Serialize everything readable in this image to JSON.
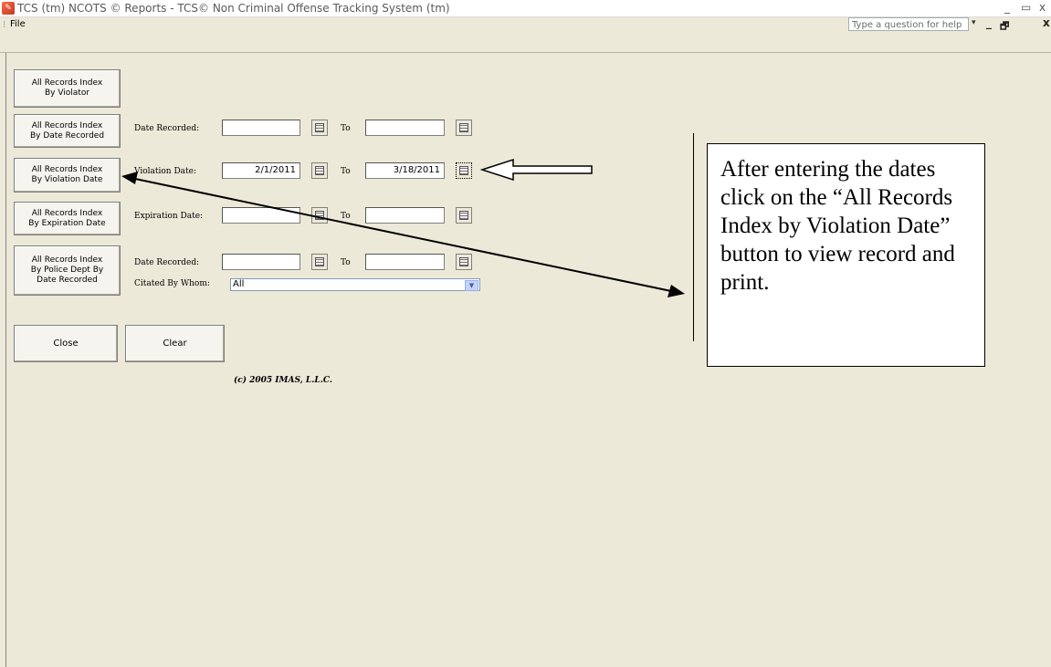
{
  "window": {
    "title": "TCS (tm) NCOTS © Reports - TCS© Non Criminal Offense Tracking System (tm)",
    "controls": [
      "_",
      "▭",
      "x"
    ]
  },
  "menubar": {
    "file_label": "File",
    "help_placeholder": "Type a question for help",
    "mdi_controls": [
      "▾",
      "_",
      "🗗",
      "x"
    ]
  },
  "report_buttons": [
    {
      "label_lines": [
        "All Records Index",
        "By Violator"
      ]
    },
    {
      "label_lines": [
        "All Records Index",
        "By Date Recorded"
      ]
    },
    {
      "label_lines": [
        "All Records Index",
        "By Violation Date"
      ]
    },
    {
      "label_lines": [
        "All Records Index",
        "By Expiration Date"
      ]
    },
    {
      "label_lines": [
        "All Records Index",
        "By Police Dept By",
        "Date Recorded"
      ]
    }
  ],
  "filters": {
    "date_recorded": {
      "label": "Date Recorded:",
      "from": "",
      "to": "",
      "to_label": "To"
    },
    "violation_date": {
      "label": "Violation Date:",
      "from": "2/1/2011",
      "to": "3/18/2011",
      "to_label": "To"
    },
    "expiration_date": {
      "label": "Expiration Date:",
      "from": "",
      "to": "",
      "to_label": "To"
    },
    "police_date_recorded": {
      "label": "Date Recorded:",
      "from": "",
      "to": "",
      "to_label": "To"
    },
    "cited_by": {
      "label": "Citated By Whom:",
      "value": "All"
    }
  },
  "actions": {
    "close_label": "Close",
    "clear_label": "Clear"
  },
  "copyright": "(c) 2005 IMAS, L.L.C.",
  "callout": {
    "text": "After entering the dates click on the “All Records Index by Violation Date” button to view record and print."
  }
}
